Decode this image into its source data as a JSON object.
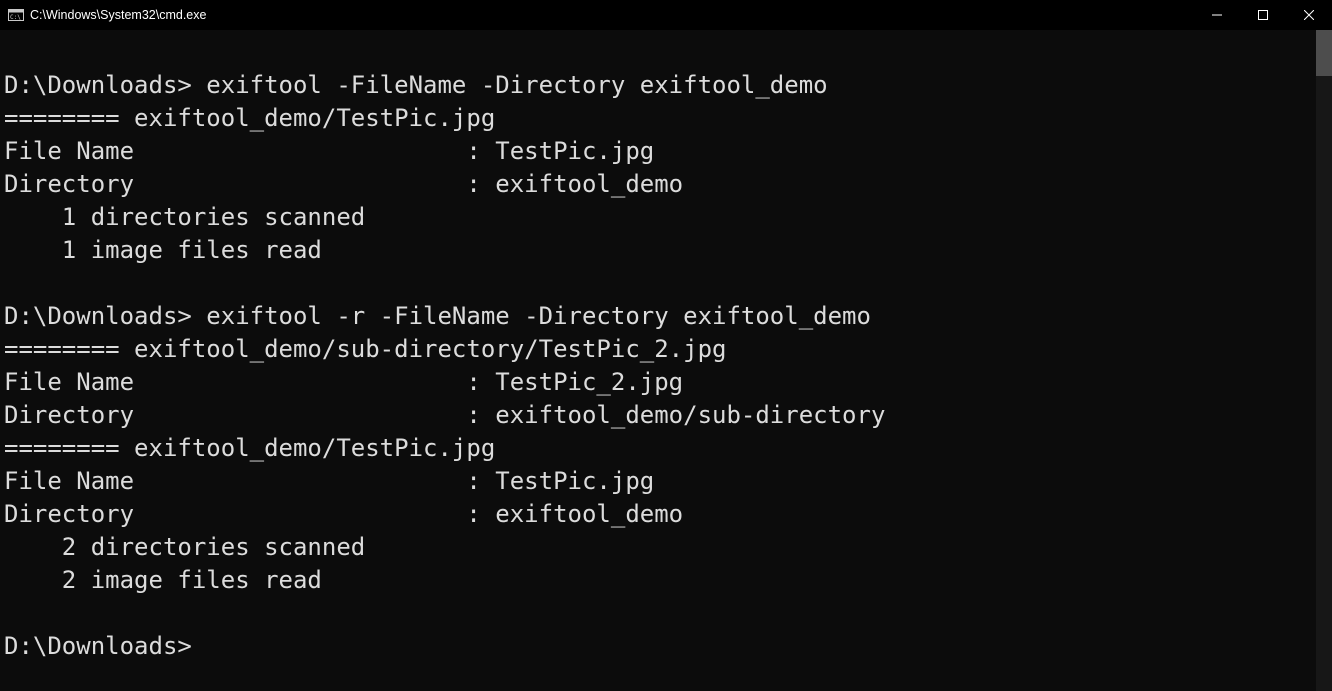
{
  "window": {
    "title": "C:\\Windows\\System32\\cmd.exe"
  },
  "terminal": {
    "lines": [
      "",
      "D:\\Downloads> exiftool -FileName -Directory exiftool_demo",
      "======== exiftool_demo/TestPic.jpg",
      "File Name                       : TestPic.jpg",
      "Directory                       : exiftool_demo",
      "    1 directories scanned",
      "    1 image files read",
      "",
      "D:\\Downloads> exiftool -r -FileName -Directory exiftool_demo",
      "======== exiftool_demo/sub-directory/TestPic_2.jpg",
      "File Name                       : TestPic_2.jpg",
      "Directory                       : exiftool_demo/sub-directory",
      "======== exiftool_demo/TestPic.jpg",
      "File Name                       : TestPic.jpg",
      "Directory                       : exiftool_demo",
      "    2 directories scanned",
      "    2 image files read",
      "",
      "D:\\Downloads>"
    ]
  }
}
